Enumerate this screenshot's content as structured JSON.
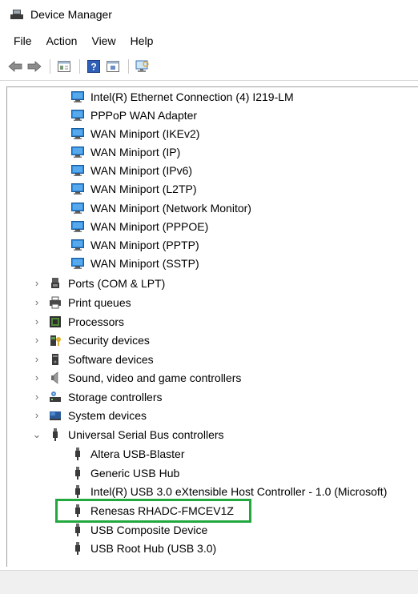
{
  "window": {
    "title": "Device Manager",
    "icon": "device-manager-icon"
  },
  "menu": {
    "file": "File",
    "action": "Action",
    "view": "View",
    "help": "Help"
  },
  "toolbar": {
    "buttons": [
      "back-arrow-icon",
      "forward-arrow-icon",
      "properties-icon",
      "help-icon",
      "update-driver-icon",
      "scan-hardware-icon"
    ]
  },
  "tree": {
    "network_adapters": [
      "Intel(R) Ethernet Connection (4) I219-LM",
      "PPPoP WAN Adapter",
      "WAN Miniport (IKEv2)",
      "WAN Miniport (IP)",
      "WAN Miniport (IPv6)",
      "WAN Miniport (L2TP)",
      "WAN Miniport (Network Monitor)",
      "WAN Miniport (PPPOE)",
      "WAN Miniport (PPTP)",
      "WAN Miniport (SSTP)"
    ],
    "categories": {
      "ports": "Ports (COM & LPT)",
      "print_queues": "Print queues",
      "processors": "Processors",
      "security_devices": "Security devices",
      "software_devices": "Software devices",
      "sound": "Sound, video and game controllers",
      "storage": "Storage controllers",
      "system": "System devices",
      "usb": "Universal Serial Bus controllers"
    },
    "usb_devices": [
      "Altera USB-Blaster",
      "Generic USB Hub",
      "Intel(R) USB 3.0 eXtensible Host Controller - 1.0 (Microsoft)",
      "Renesas RHADC-FMCEV1Z",
      "USB Composite Device",
      "USB Root Hub (USB 3.0)"
    ],
    "expander_collapsed": "›",
    "expander_expanded": "⌄"
  },
  "highlight": {
    "color": "#23a83f",
    "target": "Renesas RHADC-FMCEV1Z"
  }
}
